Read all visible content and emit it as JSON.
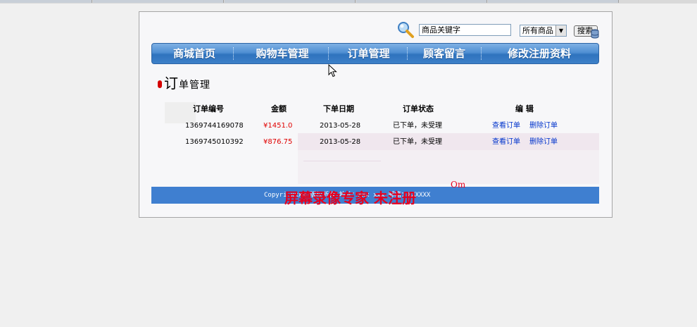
{
  "search": {
    "input_value": "商品关键字",
    "category_selected": "所有商品",
    "button_label": "搜索"
  },
  "nav": {
    "items": [
      "商城首页",
      "购物车管理",
      "订单管理",
      "顾客留言",
      "修改注册资料"
    ]
  },
  "section": {
    "title_first": "订",
    "title_rest": "单管理"
  },
  "orders": {
    "headers": [
      "订单编号",
      "金额",
      "下单日期",
      "订单状态",
      "编 辑"
    ],
    "rows": [
      {
        "id": "1369744169078",
        "amount": "¥1451.0",
        "date": "2013-05-28",
        "status": "已下单，未受理",
        "view": "查看订单",
        "delete": "删除订单"
      },
      {
        "id": "1369745010392",
        "amount": "¥876.75",
        "date": "2013-05-28",
        "status": "已下单，未受理",
        "view": "查看订单",
        "delete": "删除订单"
      }
    ]
  },
  "footer": {
    "text": "Copyri                    xxxx 版权所有 地址：xxx xxx 邮箱：XXXXXX"
  },
  "watermark": {
    "text": "屏幕录像专家 未注册",
    "sup": "Om"
  },
  "colors": {
    "nav_blue": "#3d80c8",
    "footer_blue": "#3f7fd0",
    "amount_red": "#e00000",
    "link_blue": "#0033cc",
    "watermark_red": "#e6001f"
  },
  "icons": [
    "magnifier-icon",
    "dropdown-arrow-icon",
    "database-icon",
    "mouse-cursor-icon",
    "title-bullet-icon"
  ]
}
